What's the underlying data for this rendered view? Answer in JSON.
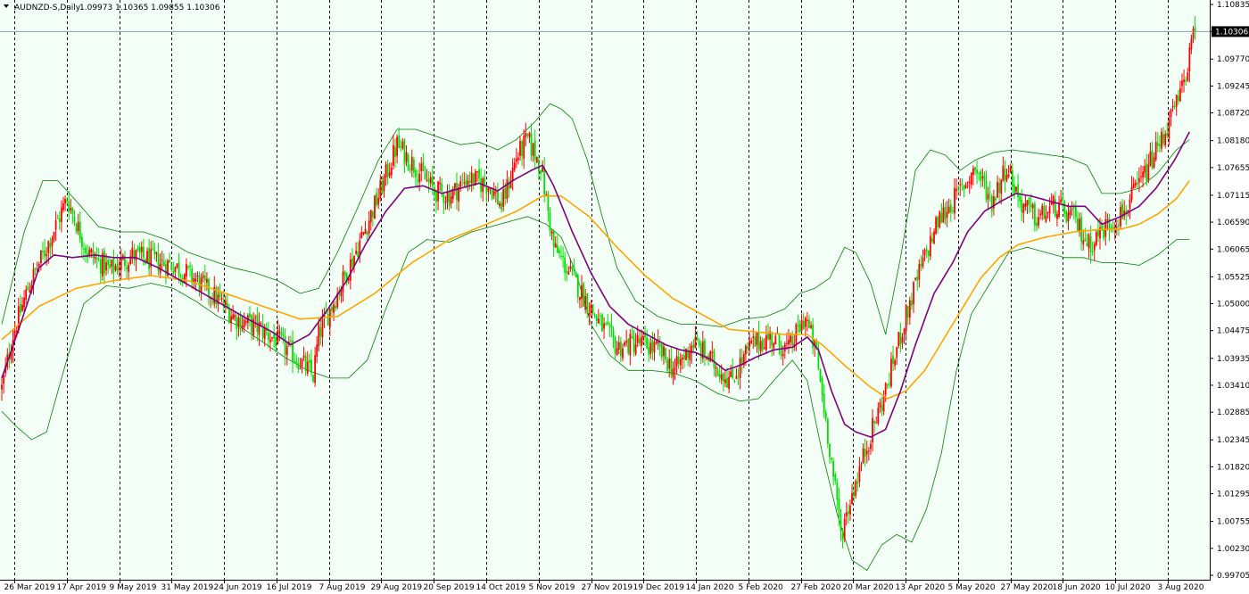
{
  "header": {
    "symbol": "AUDNZD-S,Daily",
    "quote": "1.09973 1.10365 1.09855 1.10306"
  },
  "colors": {
    "background": "#f3fff6",
    "bull": "#ff0000",
    "bear": "#00e000",
    "ma_fast": "#800080",
    "ma_slow": "#ffa500",
    "bands": "#008000",
    "current_price_line": "#8a9cb5"
  },
  "chart_data": {
    "type": "candlestick",
    "instrument": "AUDNZD-S",
    "timeframe": "Daily",
    "grid": "vertical-dashed",
    "ylim": [
      0.99705,
      1.10835
    ],
    "y_ticks": [
      "1.10835",
      "1.10306",
      "1.09770",
      "1.09245",
      "1.08720",
      "1.08180",
      "1.07655",
      "1.07115",
      "1.06590",
      "1.06065",
      "1.05525",
      "1.05000",
      "1.04475",
      "1.03935",
      "1.03410",
      "1.02885",
      "1.02345",
      "1.01820",
      "1.01295",
      "1.00755",
      "1.00230",
      "0.99705"
    ],
    "current_price": "1.10306",
    "x_ticks": [
      "26 Mar 2019",
      "17 Apr 2019",
      "9 May 2019",
      "31 May 2019",
      "24 Jun 2019",
      "16 Jul 2019",
      "7 Aug 2019",
      "29 Aug 2019",
      "20 Sep 2019",
      "14 Oct 2019",
      "5 Nov 2019",
      "27 Nov 2019",
      "19 Dec 2019",
      "14 Jan 2020",
      "5 Feb 2020",
      "27 Feb 2020",
      "20 Mar 2020",
      "13 Apr 2020",
      "5 May 2020",
      "27 May 2020",
      "18 Jun 2020",
      "10 Jul 2020",
      "3 Aug 2020"
    ],
    "close_path": [
      [
        0,
        1.0335
      ],
      [
        6,
        1.044
      ],
      [
        14,
        1.053
      ],
      [
        24,
        1.061
      ],
      [
        35,
        1.0705
      ],
      [
        46,
        1.06
      ],
      [
        58,
        1.0565
      ],
      [
        70,
        1.0595
      ],
      [
        80,
        1.0585
      ],
      [
        92,
        1.0575
      ],
      [
        103,
        1.055
      ],
      [
        114,
        1.0515
      ],
      [
        126,
        1.047
      ],
      [
        137,
        1.0455
      ],
      [
        147,
        1.043
      ],
      [
        158,
        1.0395
      ],
      [
        167,
        1.036
      ],
      [
        170,
        1.044
      ],
      [
        180,
        1.052
      ],
      [
        192,
        1.062
      ],
      [
        202,
        1.071
      ],
      [
        212,
        1.081
      ],
      [
        220,
        1.0775
      ],
      [
        232,
        1.072
      ],
      [
        240,
        1.071
      ],
      [
        250,
        1.0745
      ],
      [
        262,
        1.073
      ],
      [
        268,
        1.069
      ],
      [
        276,
        1.0785
      ],
      [
        282,
        1.082
      ],
      [
        289,
        1.077
      ],
      [
        296,
        1.061
      ],
      [
        308,
        1.054
      ],
      [
        320,
        1.0465
      ],
      [
        330,
        1.0415
      ],
      [
        341,
        1.0425
      ],
      [
        352,
        1.041
      ],
      [
        361,
        1.037
      ],
      [
        371,
        1.0425
      ],
      [
        380,
        1.039
      ],
      [
        391,
        1.035
      ],
      [
        402,
        1.042
      ],
      [
        412,
        1.0435
      ],
      [
        422,
        1.041
      ],
      [
        431,
        1.0475
      ],
      [
        437,
        1.04
      ],
      [
        444,
        1.022
      ],
      [
        450,
        1.005
      ],
      [
        456,
        1.013
      ],
      [
        465,
        1.0235
      ],
      [
        474,
        1.033
      ],
      [
        482,
        1.044
      ],
      [
        492,
        1.056
      ],
      [
        502,
        1.066
      ],
      [
        512,
        1.071
      ],
      [
        522,
        1.0765
      ],
      [
        531,
        1.07
      ],
      [
        539,
        1.077
      ],
      [
        546,
        1.07
      ],
      [
        555,
        1.0665
      ],
      [
        565,
        1.069
      ],
      [
        575,
        1.0665
      ],
      [
        583,
        1.0615
      ],
      [
        592,
        1.065
      ],
      [
        602,
        1.068
      ],
      [
        612,
        1.0745
      ],
      [
        622,
        1.082
      ],
      [
        632,
        1.0905
      ],
      [
        637,
        1.0985
      ],
      [
        640,
        1.103
      ]
    ],
    "ma_fast_path": [
      [
        0,
        1.0355
      ],
      [
        10,
        1.046
      ],
      [
        20,
        1.057
      ],
      [
        28,
        1.0595
      ],
      [
        38,
        1.059
      ],
      [
        50,
        1.0595
      ],
      [
        60,
        1.059
      ],
      [
        72,
        1.059
      ],
      [
        84,
        1.057
      ],
      [
        96,
        1.0545
      ],
      [
        108,
        1.052
      ],
      [
        120,
        1.0495
      ],
      [
        132,
        1.047
      ],
      [
        145,
        1.0445
      ],
      [
        155,
        1.042
      ],
      [
        165,
        1.044
      ],
      [
        175,
        1.049
      ],
      [
        185,
        1.0545
      ],
      [
        195,
        1.0615
      ],
      [
        206,
        1.068
      ],
      [
        216,
        1.0725
      ],
      [
        226,
        1.073
      ],
      [
        236,
        1.0715
      ],
      [
        246,
        1.0725
      ],
      [
        256,
        1.0735
      ],
      [
        266,
        1.072
      ],
      [
        274,
        1.074
      ],
      [
        284,
        1.076
      ],
      [
        290,
        1.077
      ],
      [
        296,
        1.073
      ],
      [
        306,
        1.064
      ],
      [
        316,
        1.056
      ],
      [
        326,
        1.0495
      ],
      [
        336,
        1.046
      ],
      [
        346,
        1.044
      ],
      [
        356,
        1.042
      ],
      [
        364,
        1.041
      ],
      [
        372,
        1.0405
      ],
      [
        381,
        1.039
      ],
      [
        388,
        1.037
      ],
      [
        396,
        1.038
      ],
      [
        404,
        1.0395
      ],
      [
        414,
        1.041
      ],
      [
        424,
        1.0415
      ],
      [
        432,
        1.0435
      ],
      [
        438,
        1.041
      ],
      [
        445,
        1.033
      ],
      [
        452,
        1.0265
      ],
      [
        458,
        1.025
      ],
      [
        466,
        1.024
      ],
      [
        474,
        1.0255
      ],
      [
        482,
        1.033
      ],
      [
        490,
        1.042
      ],
      [
        500,
        1.052
      ],
      [
        510,
        1.058
      ],
      [
        518,
        1.064
      ],
      [
        527,
        1.068
      ],
      [
        536,
        1.07
      ],
      [
        544,
        1.0715
      ],
      [
        552,
        1.071
      ],
      [
        562,
        1.07
      ],
      [
        572,
        1.069
      ],
      [
        581,
        1.069
      ],
      [
        590,
        1.0655
      ],
      [
        600,
        1.067
      ],
      [
        610,
        1.069
      ],
      [
        619,
        1.0725
      ],
      [
        629,
        1.078
      ],
      [
        637,
        1.0835
      ]
    ],
    "ma_slow_path": [
      [
        0,
        1.043
      ],
      [
        20,
        1.0495
      ],
      [
        40,
        1.053
      ],
      [
        60,
        1.0545
      ],
      [
        80,
        1.0555
      ],
      [
        100,
        1.0545
      ],
      [
        120,
        1.052
      ],
      [
        140,
        1.0495
      ],
      [
        160,
        1.047
      ],
      [
        180,
        1.0475
      ],
      [
        200,
        1.052
      ],
      [
        220,
        1.058
      ],
      [
        240,
        1.0625
      ],
      [
        260,
        1.0655
      ],
      [
        276,
        1.068
      ],
      [
        290,
        1.071
      ],
      [
        300,
        1.071
      ],
      [
        315,
        1.067
      ],
      [
        330,
        1.061
      ],
      [
        345,
        1.0555
      ],
      [
        360,
        1.051
      ],
      [
        375,
        1.048
      ],
      [
        390,
        1.045
      ],
      [
        405,
        1.0445
      ],
      [
        420,
        1.044
      ],
      [
        432,
        1.044
      ],
      [
        440,
        1.042
      ],
      [
        452,
        1.038
      ],
      [
        465,
        1.034
      ],
      [
        475,
        1.0315
      ],
      [
        485,
        1.033
      ],
      [
        495,
        1.037
      ],
      [
        505,
        1.043
      ],
      [
        515,
        1.049
      ],
      [
        525,
        1.055
      ],
      [
        535,
        1.059
      ],
      [
        545,
        1.0615
      ],
      [
        560,
        1.063
      ],
      [
        575,
        1.064
      ],
      [
        590,
        1.0645
      ],
      [
        600,
        1.0645
      ],
      [
        610,
        1.0655
      ],
      [
        620,
        1.0675
      ],
      [
        630,
        1.0705
      ],
      [
        637,
        1.074
      ]
    ],
    "band_upper_path": [
      [
        0,
        1.046
      ],
      [
        12,
        1.064
      ],
      [
        22,
        1.074
      ],
      [
        30,
        1.074
      ],
      [
        40,
        1.07
      ],
      [
        52,
        1.065
      ],
      [
        64,
        1.064
      ],
      [
        76,
        1.064
      ],
      [
        88,
        1.0625
      ],
      [
        100,
        1.06
      ],
      [
        112,
        1.0585
      ],
      [
        124,
        1.057
      ],
      [
        136,
        1.056
      ],
      [
        148,
        1.0545
      ],
      [
        160,
        1.052
      ],
      [
        170,
        1.053
      ],
      [
        180,
        1.06
      ],
      [
        190,
        1.068
      ],
      [
        202,
        1.078
      ],
      [
        212,
        1.084
      ],
      [
        222,
        1.084
      ],
      [
        234,
        1.0825
      ],
      [
        246,
        1.081
      ],
      [
        256,
        1.0815
      ],
      [
        266,
        1.08
      ],
      [
        276,
        1.082
      ],
      [
        286,
        1.0855
      ],
      [
        294,
        1.089
      ],
      [
        300,
        1.088
      ],
      [
        306,
        1.086
      ],
      [
        314,
        1.078
      ],
      [
        322,
        1.067
      ],
      [
        330,
        1.057
      ],
      [
        340,
        1.0505
      ],
      [
        352,
        1.0475
      ],
      [
        364,
        1.046
      ],
      [
        374,
        1.046
      ],
      [
        386,
        1.0455
      ],
      [
        398,
        1.047
      ],
      [
        410,
        1.0475
      ],
      [
        420,
        1.049
      ],
      [
        428,
        1.052
      ],
      [
        436,
        1.053
      ],
      [
        444,
        1.055
      ],
      [
        452,
        1.061
      ],
      [
        458,
        1.06
      ],
      [
        466,
        1.054
      ],
      [
        474,
        1.044
      ],
      [
        482,
        1.059
      ],
      [
        490,
        1.076
      ],
      [
        498,
        1.08
      ],
      [
        506,
        1.079
      ],
      [
        514,
        1.076
      ],
      [
        522,
        1.078
      ],
      [
        532,
        1.0795
      ],
      [
        542,
        1.08
      ],
      [
        552,
        1.0795
      ],
      [
        562,
        1.079
      ],
      [
        572,
        1.0785
      ],
      [
        582,
        1.077
      ],
      [
        590,
        1.0715
      ],
      [
        600,
        1.0715
      ],
      [
        610,
        1.0725
      ],
      [
        620,
        1.0755
      ],
      [
        630,
        1.08
      ],
      [
        637,
        1.082
      ]
    ],
    "band_lower_path": [
      [
        0,
        1.029
      ],
      [
        8,
        1.026
      ],
      [
        16,
        1.0235
      ],
      [
        24,
        1.025
      ],
      [
        34,
        1.038
      ],
      [
        44,
        1.05
      ],
      [
        56,
        1.0535
      ],
      [
        68,
        1.053
      ],
      [
        80,
        1.054
      ],
      [
        92,
        1.053
      ],
      [
        104,
        1.0505
      ],
      [
        116,
        1.0475
      ],
      [
        128,
        1.0455
      ],
      [
        140,
        1.0425
      ],
      [
        152,
        1.0395
      ],
      [
        164,
        1.037
      ],
      [
        176,
        1.0355
      ],
      [
        186,
        1.0355
      ],
      [
        196,
        1.039
      ],
      [
        206,
        1.049
      ],
      [
        218,
        1.06
      ],
      [
        228,
        1.0625
      ],
      [
        240,
        1.062
      ],
      [
        252,
        1.064
      ],
      [
        262,
        1.065
      ],
      [
        272,
        1.066
      ],
      [
        282,
        1.067
      ],
      [
        292,
        1.0655
      ],
      [
        300,
        1.063
      ],
      [
        308,
        1.056
      ],
      [
        316,
        1.046
      ],
      [
        326,
        1.04
      ],
      [
        336,
        1.037
      ],
      [
        348,
        1.037
      ],
      [
        360,
        1.0365
      ],
      [
        372,
        1.035
      ],
      [
        384,
        1.0325
      ],
      [
        396,
        1.031
      ],
      [
        406,
        1.0315
      ],
      [
        414,
        1.035
      ],
      [
        424,
        1.039
      ],
      [
        432,
        1.035
      ],
      [
        440,
        1.021
      ],
      [
        448,
        1.009
      ],
      [
        456,
        1.0
      ],
      [
        464,
        0.998
      ],
      [
        472,
        1.003
      ],
      [
        480,
        1.005
      ],
      [
        488,
        1.0035
      ],
      [
        496,
        1.01
      ],
      [
        504,
        1.021
      ],
      [
        512,
        1.037
      ],
      [
        520,
        1.048
      ],
      [
        530,
        1.054
      ],
      [
        540,
        1.06
      ],
      [
        550,
        1.061
      ],
      [
        560,
        1.06
      ],
      [
        570,
        1.059
      ],
      [
        580,
        1.059
      ],
      [
        590,
        1.058
      ],
      [
        600,
        1.058
      ],
      [
        610,
        1.0575
      ],
      [
        620,
        1.0595
      ],
      [
        630,
        1.0625
      ],
      [
        637,
        1.0625
      ]
    ]
  }
}
